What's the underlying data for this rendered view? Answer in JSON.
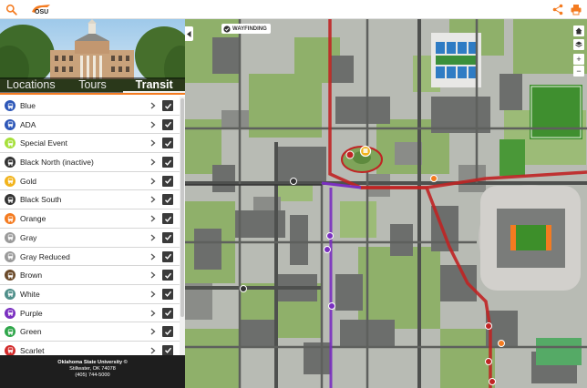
{
  "topbar": {
    "search_icon": "search-icon",
    "logo": "osu-brand-logo",
    "share_icon": "share-icon",
    "print_icon": "print-icon",
    "accent": "#f47b20"
  },
  "sidebar": {
    "tabs": [
      {
        "label": "Locations",
        "active": false
      },
      {
        "label": "Tours",
        "active": false
      },
      {
        "label": "Transit",
        "active": true
      }
    ],
    "routes": [
      {
        "label": "Blue",
        "color": "#2d57b8",
        "checked": true
      },
      {
        "label": "ADA",
        "color": "#2d57b8",
        "checked": true
      },
      {
        "label": "Special Event",
        "color": "#a6e03a",
        "checked": true
      },
      {
        "label": "Black North (inactive)",
        "color": "#333333",
        "checked": true
      },
      {
        "label": "Gold",
        "color": "#f2b31b",
        "checked": true
      },
      {
        "label": "Black South",
        "color": "#333333",
        "checked": true
      },
      {
        "label": "Orange",
        "color": "#f47b20",
        "checked": true
      },
      {
        "label": "Gray",
        "color": "#9a9a9a",
        "checked": true
      },
      {
        "label": "Gray Reduced",
        "color": "#9a9a9a",
        "checked": true
      },
      {
        "label": "Brown",
        "color": "#6b4a2a",
        "checked": true
      },
      {
        "label": "White",
        "color": "#4f8f8a",
        "checked": true
      },
      {
        "label": "Purple",
        "color": "#7a2fc0",
        "checked": true
      },
      {
        "label": "Green",
        "color": "#2fa64a",
        "checked": true
      },
      {
        "label": "Scarlet",
        "color": "#d22a2a",
        "checked": true
      }
    ],
    "footer": {
      "name": "Oklahoma State University ©",
      "address": "Stillwater, OK  74078",
      "phone": "(405) 744-5000"
    }
  },
  "map": {
    "wayfinding_label": "WAYFINDING",
    "controls": [
      "home-icon",
      "layers-icon",
      "zoom-in-icon",
      "zoom-out-icon"
    ],
    "zoom_in_label": "+",
    "zoom_out_label": "−"
  }
}
